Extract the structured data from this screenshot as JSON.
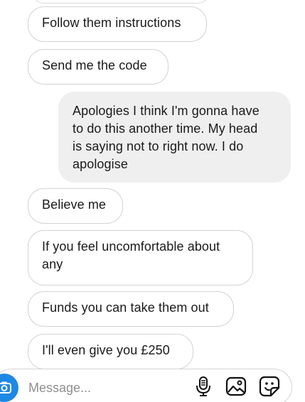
{
  "messages": [
    {
      "direction": "incoming",
      "text": "Follow them instructions"
    },
    {
      "direction": "incoming",
      "text": "Send me the code"
    },
    {
      "direction": "outgoing",
      "lines": [
        "Apologies I think I'm gonna have",
        "to do this another time. My head",
        "is saying not to right now. I do",
        "apologise"
      ]
    },
    {
      "direction": "incoming",
      "text": "Believe me"
    },
    {
      "direction": "incoming",
      "lines": [
        "If you feel uncomfortable about",
        "any"
      ]
    },
    {
      "direction": "incoming",
      "text": "Funds you can take them out"
    },
    {
      "direction": "incoming",
      "text": "I'll even give you £250"
    }
  ],
  "composer": {
    "placeholder": "Message...",
    "left_icon": "camera-icon",
    "right_icons": [
      "microphone-icon",
      "image-gallery-icon",
      "sticker-icon"
    ],
    "accent_color": "#1e88e5"
  }
}
